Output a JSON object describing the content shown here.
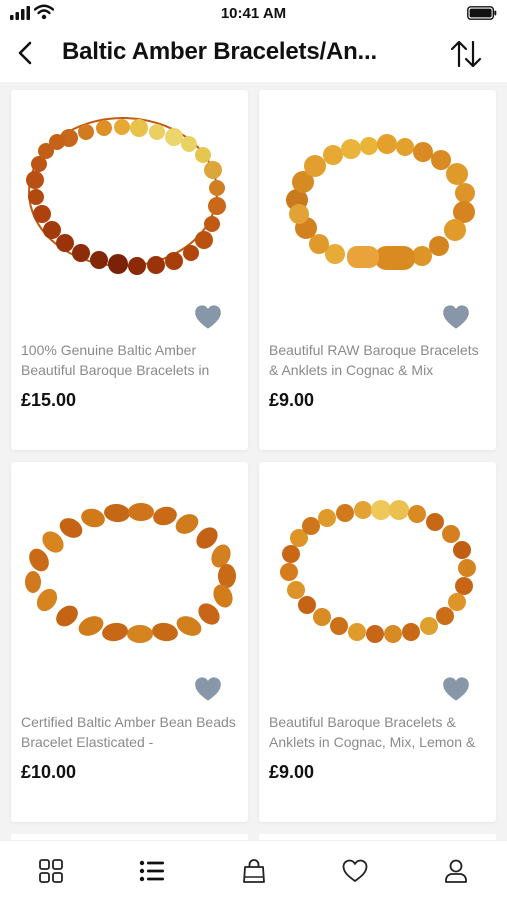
{
  "status_bar": {
    "time": "10:41 AM"
  },
  "header": {
    "title": "Baltic Amber Bracelets/An..."
  },
  "products": [
    {
      "title": "100% Genuine Baltic Amber Beautiful Baroque Bracelets in",
      "price": "£15.00",
      "image": "baroque-rainbow-amber-bracelet"
    },
    {
      "title": "Beautiful RAW Baroque Bracelets & Anklets in Cognac & Mix",
      "price": "£9.00",
      "image": "raw-cognac-amber-bracelet"
    },
    {
      "title": "Certified Baltic Amber Bean Beads Bracelet Elasticated -",
      "price": "£10.00",
      "image": "bean-beads-amber-bracelet"
    },
    {
      "title": "Beautiful Baroque Bracelets & Anklets in Cognac, Mix, Lemon &",
      "price": "£9.00",
      "image": "baroque-mix-amber-bracelet"
    }
  ],
  "bottom_nav": [
    {
      "icon": "grid-icon",
      "active": false
    },
    {
      "icon": "list-icon",
      "active": true
    },
    {
      "icon": "shopping-bag-icon",
      "active": false
    },
    {
      "icon": "heart-icon",
      "active": false
    },
    {
      "icon": "user-icon",
      "active": false
    }
  ],
  "colors": {
    "favorite": "#8797a8",
    "title_text": "#8a8a8a",
    "background": "#f3f3f3"
  }
}
